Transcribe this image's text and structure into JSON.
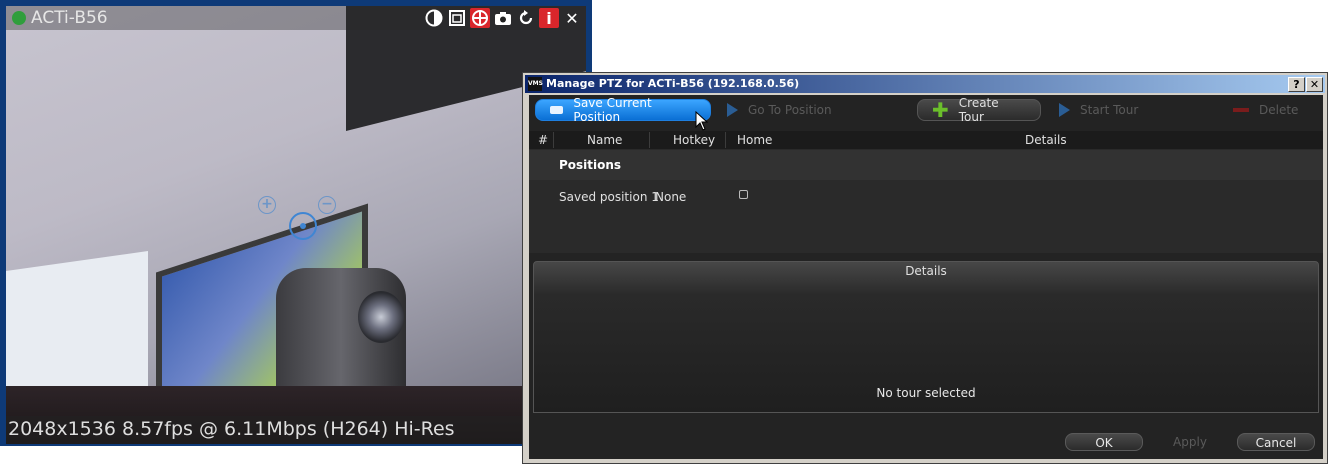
{
  "camera": {
    "title": "ACTi-B56",
    "status_color": "#2f9e3c",
    "stats": "2048x1536 8.57fps @ 6.11Mbps (H264) Hi-Res",
    "tools": [
      {
        "name": "contrast-icon",
        "glyph": "◐"
      },
      {
        "name": "window-icon",
        "glyph": "⧉"
      },
      {
        "name": "ptz-icon",
        "glyph": "⊕"
      },
      {
        "name": "snapshot-icon",
        "glyph": "📷"
      },
      {
        "name": "refresh-icon",
        "glyph": "↻"
      },
      {
        "name": "info-icon",
        "glyph": "i"
      },
      {
        "name": "close-icon",
        "glyph": "✕"
      }
    ]
  },
  "dialog": {
    "app_icon": "VMS",
    "title": "Manage PTZ for ACTi-B56 (192.168.0.56)",
    "help": "?",
    "close": "✕",
    "toolbar": {
      "save_current_position": "Save Current Position",
      "go_to_position": "Go To Position",
      "create_tour": "Create Tour",
      "start_tour": "Start Tour",
      "delete": "Delete"
    },
    "table": {
      "columns": [
        "#",
        "Name",
        "Hotkey",
        "Home",
        "Details"
      ],
      "group": "Positions",
      "rows": [
        {
          "name": "Saved position 1",
          "hotkey": "None",
          "home": false
        }
      ]
    },
    "details": {
      "title": "Details",
      "empty_text": "No tour selected"
    },
    "buttons": {
      "ok": "OK",
      "apply": "Apply",
      "cancel": "Cancel"
    }
  }
}
